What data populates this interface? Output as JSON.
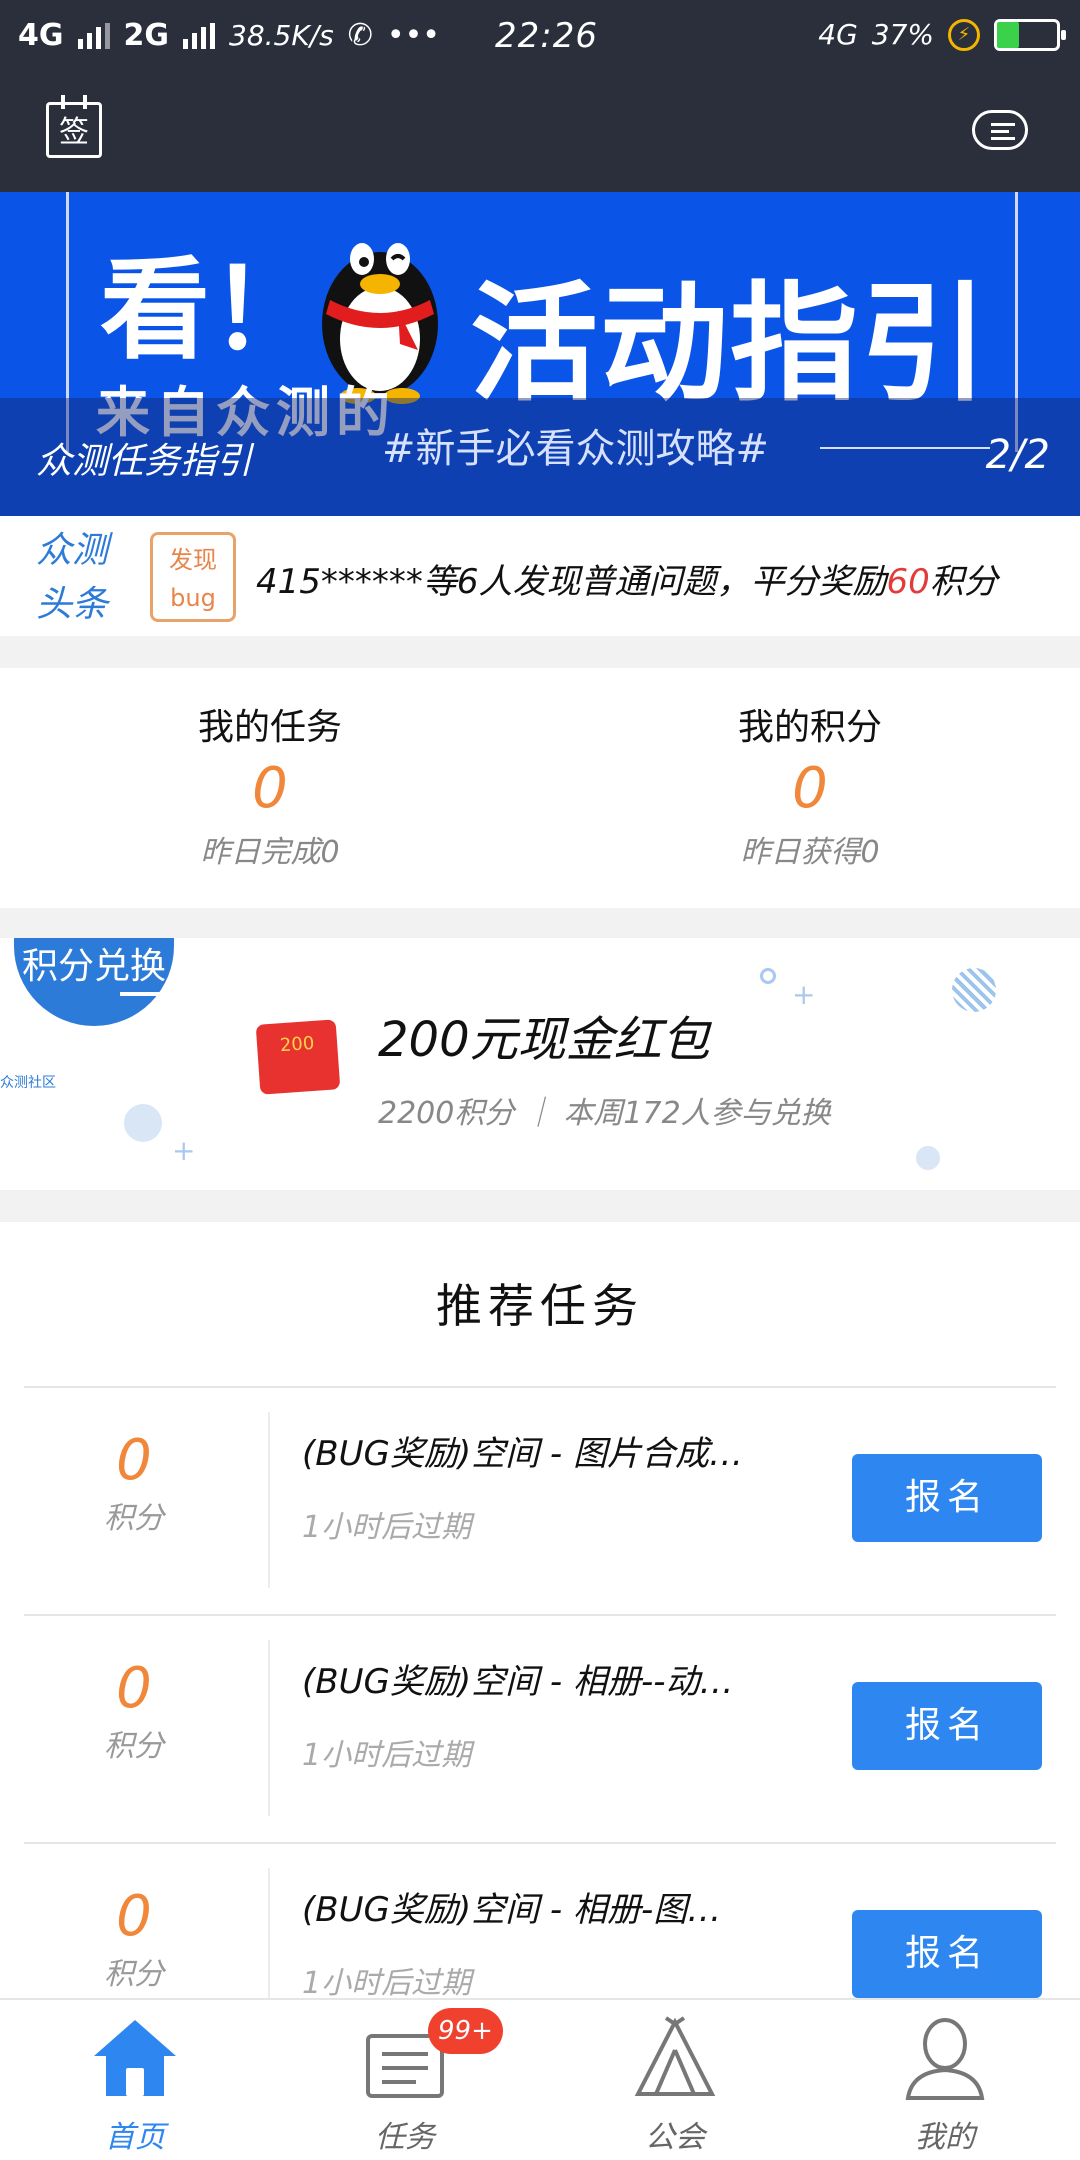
{
  "status_bar": {
    "net1": "4G",
    "net2": "2G",
    "speed": "38.5K/s",
    "dots": "•••",
    "time": "22:26",
    "net_right": "4G",
    "battery_pct": "37%",
    "battery_level": 0.37,
    "battery_color": "#3cd14a"
  },
  "header": {
    "signin_icon_text": "签"
  },
  "banner": {
    "see_text": "看！",
    "title": "活动指引",
    "from_text": "来自众测的",
    "caption": "众测任务指引",
    "tagline": "#新手必看众测攻略#",
    "pager": "2/2",
    "bg_color": "#0a55e8"
  },
  "headline": {
    "brand_line1": "众测",
    "brand_line2": "头条",
    "badge_line1": "发现",
    "badge_line2": "bug",
    "news_prefix": "415******等6人发现普通问题，平分奖励",
    "news_highlight": "60",
    "news_suffix": "积分"
  },
  "stats": {
    "tasks_label": "我的任务",
    "tasks_value": "0",
    "tasks_sub": "昨日完成0",
    "points_label": "我的积分",
    "points_value": "0",
    "points_sub": "昨日获得0"
  },
  "exchange": {
    "tag": "积分兑换",
    "tiny_text": "众测社区",
    "pack_amount": "200",
    "prize": "200元现金红包",
    "meta": "2200积分 ｜ 本周172人参与兑换"
  },
  "tasks": {
    "heading": "推荐任务",
    "items": [
      {
        "points": "0",
        "unit": "积分",
        "title": "(BUG奖励)空间 - 图片合成…",
        "expires": "1小时后过期",
        "button": "报名"
      },
      {
        "points": "0",
        "unit": "积分",
        "title": "(BUG奖励)空间 - 相册--动…",
        "expires": "1小时后过期",
        "button": "报名"
      },
      {
        "points": "0",
        "unit": "积分",
        "title": "(BUG奖励)空间 - 相册-图…",
        "expires": "1小时后过期",
        "button": "报名"
      }
    ]
  },
  "bottom_nav": {
    "items": [
      {
        "label": "首页",
        "icon": "home-icon",
        "active": true
      },
      {
        "label": "任务",
        "icon": "task-list-icon",
        "badge": "99+"
      },
      {
        "label": "公会",
        "icon": "tent-icon"
      },
      {
        "label": "我的",
        "icon": "person-icon"
      }
    ],
    "accent": "#2e86f0"
  }
}
